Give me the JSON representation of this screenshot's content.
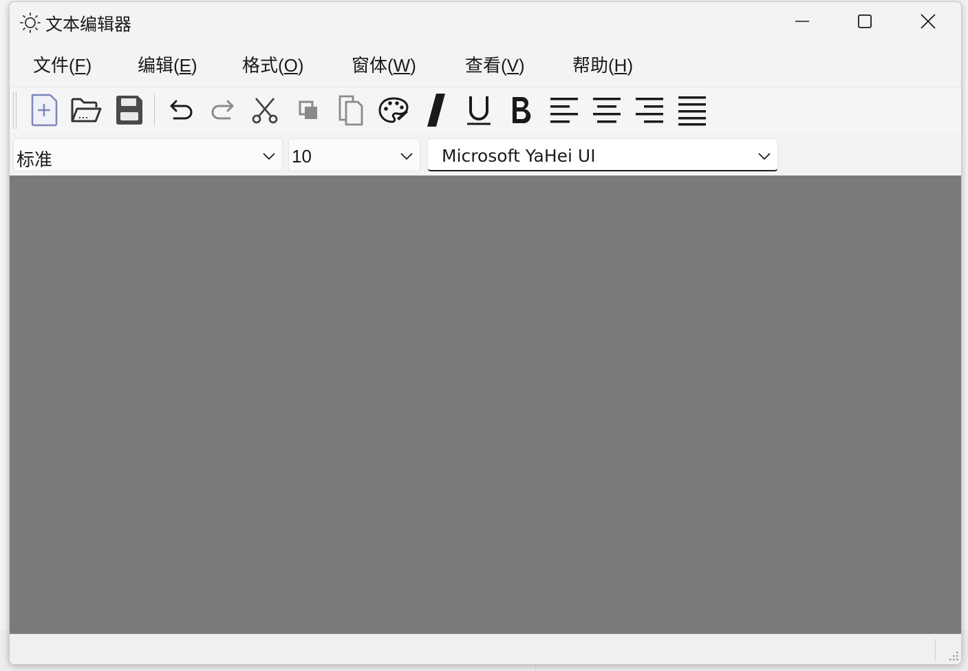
{
  "window": {
    "title": "文本编辑器",
    "controls": {
      "minimize_icon": "minimize-icon",
      "maximize_icon": "maximize-icon",
      "close_icon": "close-icon"
    }
  },
  "menu": [
    {
      "label": "文件(",
      "key": "F",
      "tail": ")"
    },
    {
      "label": "编辑(",
      "key": "E",
      "tail": ")"
    },
    {
      "label": "格式(",
      "key": "O",
      "tail": ")"
    },
    {
      "label": "窗体(",
      "key": "W",
      "tail": ")"
    },
    {
      "label": "查看(",
      "key": "V",
      "tail": ")"
    },
    {
      "label": "帮助(",
      "key": "H",
      "tail": ")"
    }
  ],
  "toolbar": {
    "buttons": [
      "new-file-icon",
      "open-folder-icon",
      "save-icon",
      "undo-icon",
      "redo-icon",
      "cut-icon",
      "copy-icon",
      "paste-icon",
      "palette-icon",
      "italic-icon",
      "underline-icon",
      "bold-icon",
      "align-left-icon",
      "align-center-icon",
      "align-right-icon",
      "justify-icon"
    ]
  },
  "combos": {
    "style": {
      "value": "标准"
    },
    "size": {
      "value": "10"
    },
    "font": {
      "value": "Microsoft YaHei UI"
    }
  },
  "colors": {
    "client_area": "#7a7a7a",
    "window_bg": "#f3f3f3",
    "accent_new_file": "#7b86b8"
  }
}
